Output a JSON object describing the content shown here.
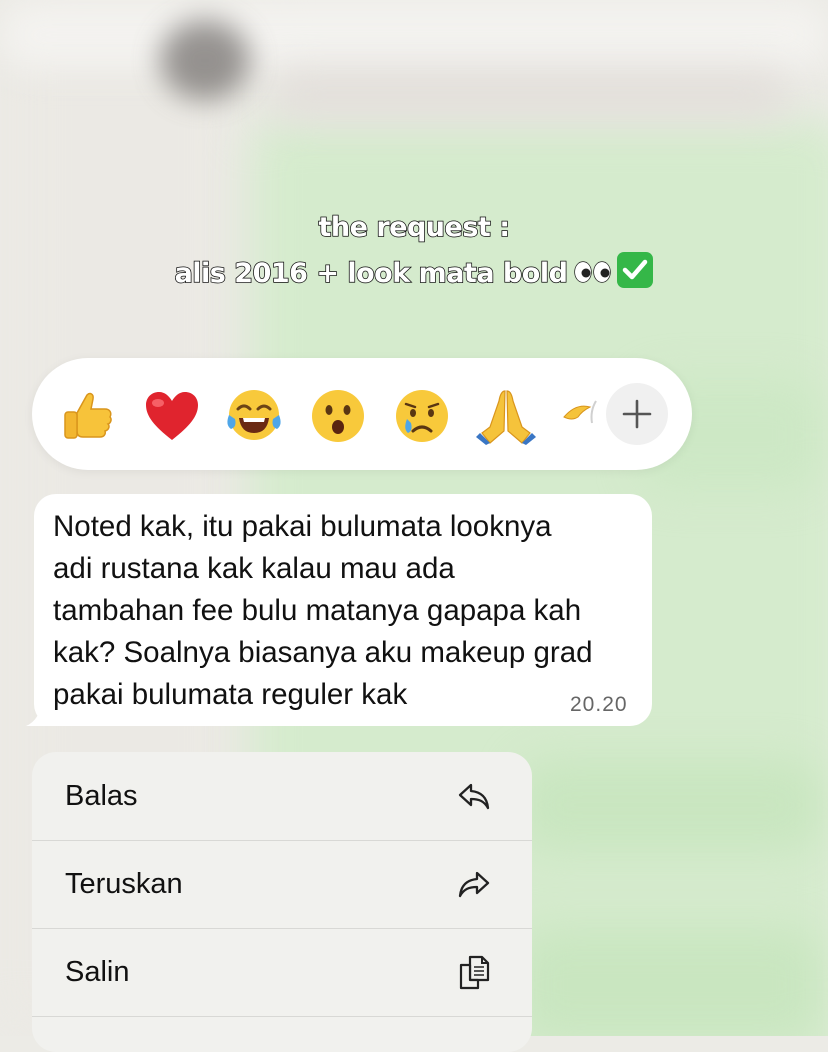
{
  "caption": {
    "line1": "the request :",
    "line2": "alis 2016 + look mata bold"
  },
  "reactions": {
    "emojis": [
      "thumbs-up",
      "red-heart",
      "face-with-tears-of-joy",
      "hushed-face",
      "crying-face",
      "folded-hands",
      "partial-emoji"
    ],
    "more_icon": "plus-icon"
  },
  "message": {
    "text": "Noted kak, itu pakai bulumata looknya\nadi rustana kak kalau mau ada\ntambahan fee bulu matanya gapapa kah\nkak? Soalnya biasanya aku makeup grad\npakai bulumata reguler kak",
    "time": "20.20"
  },
  "menu": {
    "items": [
      {
        "label": "Balas",
        "icon": "reply-icon"
      },
      {
        "label": "Teruskan",
        "icon": "forward-icon"
      },
      {
        "label": "Salin",
        "icon": "copy-icon"
      }
    ]
  },
  "colors": {
    "chat_bg": "#d5ebcd",
    "bubble": "#ffffff",
    "check_green": "#35b748"
  }
}
